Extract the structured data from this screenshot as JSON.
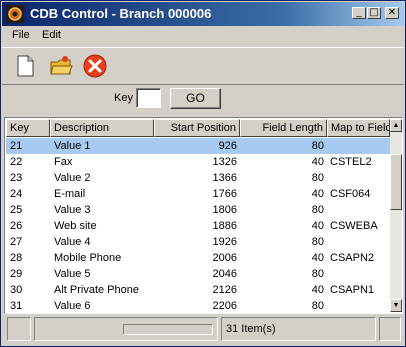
{
  "window": {
    "title": "CDB Control - Branch 000006"
  },
  "menu": [
    "File",
    "Edit"
  ],
  "toolbar": {
    "icons": [
      "new-document-icon",
      "open-folder-icon",
      "delete-icon"
    ],
    "accent_red": "#e8401c"
  },
  "key_search": {
    "label": "Key",
    "value": "",
    "go_label": "GO"
  },
  "table": {
    "columns": [
      "Key",
      "Description",
      "Start Position",
      "Field Length",
      "Map to Field"
    ],
    "selected_index": 0,
    "rows": [
      [
        "21",
        "Value 1",
        "926",
        "80",
        ""
      ],
      [
        "22",
        "Fax",
        "1326",
        "40",
        "CSTEL2"
      ],
      [
        "23",
        "Value 2",
        "1366",
        "80",
        ""
      ],
      [
        "24",
        "E-mail",
        "1766",
        "40",
        "CSF064"
      ],
      [
        "25",
        "Value 3",
        "1806",
        "80",
        ""
      ],
      [
        "26",
        "Web site",
        "1886",
        "40",
        "CSWEBA"
      ],
      [
        "27",
        "Value 4",
        "1926",
        "80",
        ""
      ],
      [
        "28",
        "Mobile Phone",
        "2006",
        "40",
        "CSAPN2"
      ],
      [
        "29",
        "Value 5",
        "2046",
        "80",
        ""
      ],
      [
        "30",
        "Alt Private Phone",
        "2126",
        "40",
        "CSAPN1"
      ],
      [
        "31",
        "Value 6",
        "2206",
        "80",
        ""
      ]
    ]
  },
  "status": {
    "item_count": "31 Item(s)"
  },
  "colors": {
    "selection": "#a6caf0",
    "titlebar": "#0a246a",
    "face": "#d4d0c8"
  }
}
